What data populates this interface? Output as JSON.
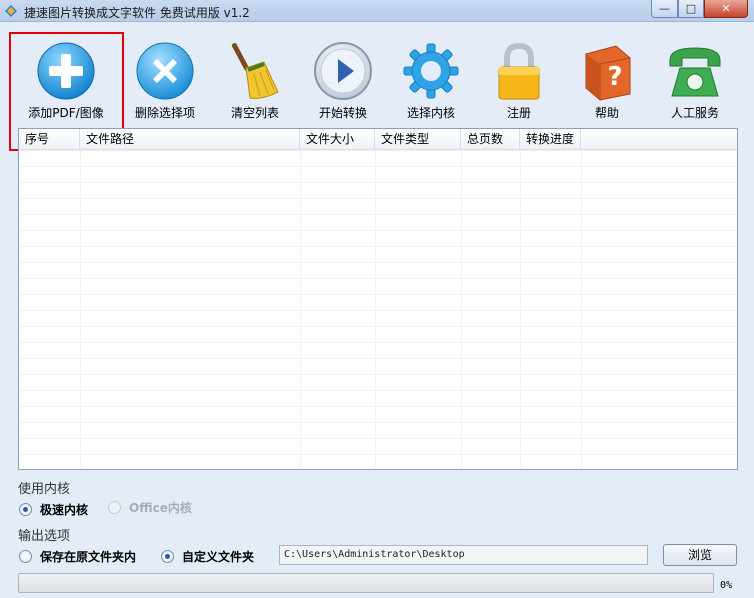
{
  "window": {
    "title": "捷速图片转换成文字软件 免费试用版 v1.2",
    "controls": {
      "minimize": "—",
      "maximize": "□",
      "close": "✕"
    }
  },
  "toolbar": [
    {
      "label": "添加PDF/图像",
      "icon": "plus-circle-icon",
      "color": "#2aa3e3"
    },
    {
      "label": "删除选择项",
      "icon": "x-circle-icon",
      "color": "#3cb0e6"
    },
    {
      "label": "清空列表",
      "icon": "broom-icon",
      "color": "#e8b92a"
    },
    {
      "label": "开始转换",
      "icon": "play-circle-icon",
      "color": "#3a6fb8"
    },
    {
      "label": "选择内核",
      "icon": "gear-icon",
      "color": "#36a6e4"
    },
    {
      "label": "注册",
      "icon": "lock-icon",
      "color": "#f2b51b"
    },
    {
      "label": "帮助",
      "icon": "help-book-icon",
      "color": "#e26b2a"
    },
    {
      "label": "人工服务",
      "icon": "telephone-icon",
      "color": "#37a04a"
    }
  ],
  "table": {
    "columns": [
      "序号",
      "文件路径",
      "文件大小",
      "文件类型",
      "总页数",
      "转换进度"
    ],
    "rows": []
  },
  "engine": {
    "label": "使用内核",
    "options": [
      {
        "label": "极速内核",
        "selected": true,
        "enabled": true
      },
      {
        "label": "Office内核",
        "selected": false,
        "enabled": false
      }
    ]
  },
  "output": {
    "label": "输出选项",
    "options": [
      {
        "label": "保存在原文件夹内",
        "selected": false
      },
      {
        "label": "自定义文件夹",
        "selected": true
      }
    ],
    "path": "C:\\Users\\Administrator\\Desktop",
    "browse_label": "浏览"
  },
  "progress": {
    "value": 0,
    "text": "0%"
  },
  "colors": {
    "highlight": "#e00000"
  }
}
